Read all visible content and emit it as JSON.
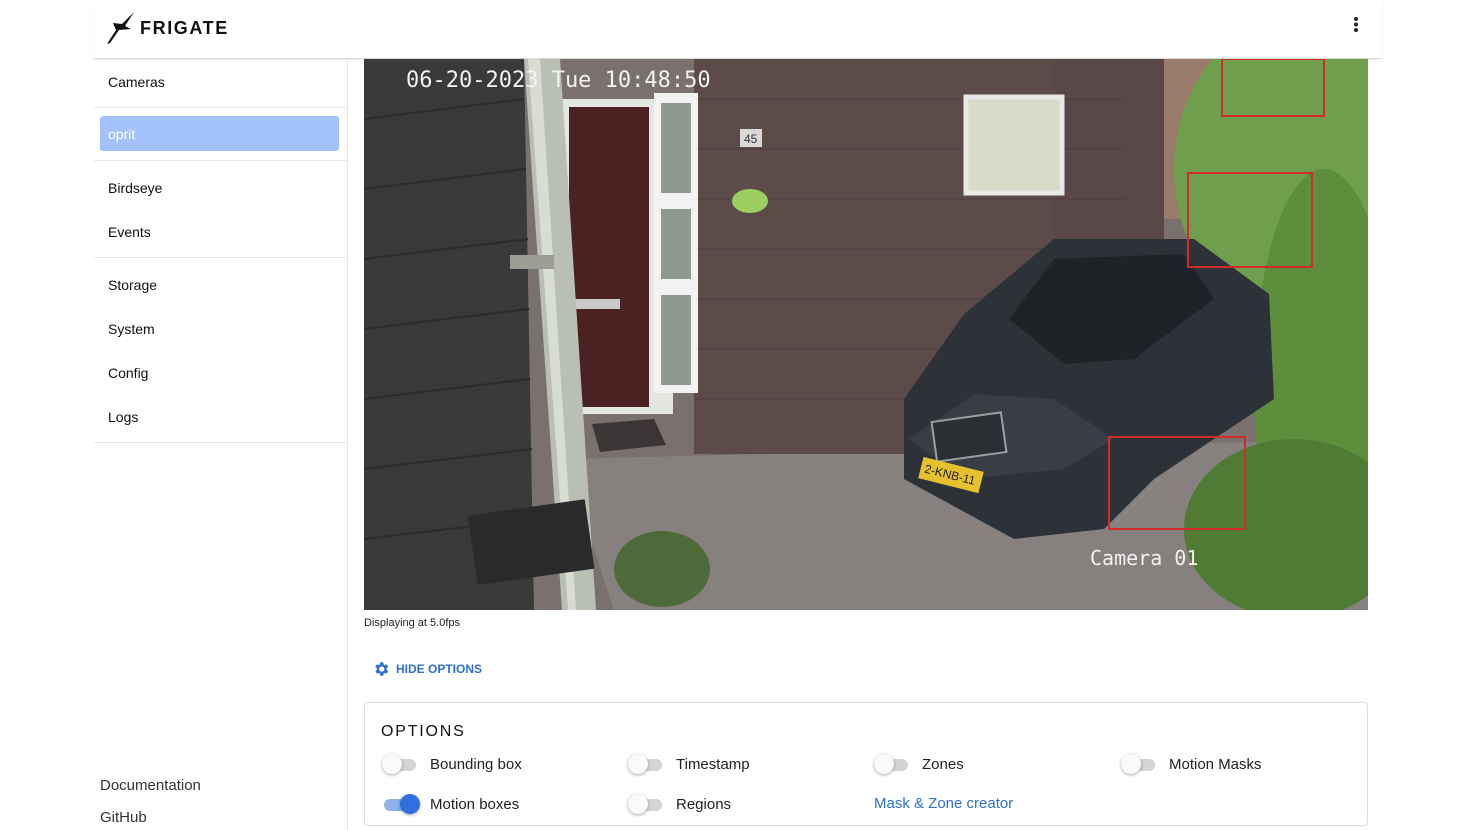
{
  "app": {
    "name": "FRIGATE"
  },
  "sidebar": {
    "items": [
      {
        "label": "Cameras"
      },
      {
        "label": "oprit"
      },
      {
        "label": "Birdseye"
      },
      {
        "label": "Events"
      },
      {
        "label": "Storage"
      },
      {
        "label": "System"
      },
      {
        "label": "Config"
      },
      {
        "label": "Logs"
      }
    ],
    "footer": [
      {
        "label": "Documentation"
      },
      {
        "label": "GitHub"
      }
    ]
  },
  "camera": {
    "osd_datetime": "06-20-2023 Tue 10:48:50",
    "osd_name": "Camera 01",
    "house_number": "45",
    "plate": "2-KNB-11",
    "fps_text": "Displaying at 5.0fps",
    "motion_box_color": "#d32a2a"
  },
  "controls": {
    "hide_options_label": "HIDE OPTIONS",
    "options_title": "OPTIONS",
    "toggles": [
      {
        "label": "Bounding box",
        "on": false
      },
      {
        "label": "Timestamp",
        "on": false
      },
      {
        "label": "Zones",
        "on": false
      },
      {
        "label": "Motion Masks",
        "on": false
      },
      {
        "label": "Motion boxes",
        "on": true
      },
      {
        "label": "Regions",
        "on": false
      }
    ],
    "mask_zone_link": "Mask & Zone creator"
  },
  "colors": {
    "accent": "#2f6fcf",
    "active_nav": "#a3c1fb"
  },
  "icons": {
    "logo": "frigate-bird-icon",
    "menu": "kebab-menu-icon",
    "options": "gear-icon"
  }
}
